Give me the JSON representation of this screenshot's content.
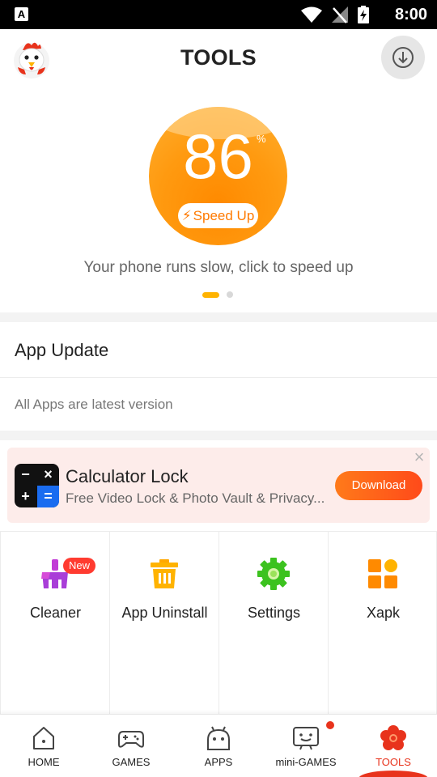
{
  "status_bar": {
    "time": "8:00",
    "left_icon": "A"
  },
  "header": {
    "title": "TOOLS"
  },
  "speed": {
    "score": "86",
    "unit": "%",
    "button_label": "Speed Up",
    "hint": "Your phone runs slow, click to speed up"
  },
  "app_update": {
    "title": "App Update",
    "status": "All Apps are latest version"
  },
  "ad": {
    "title": "Calculator Lock",
    "subtitle": "Free Video Lock & Photo Vault & Privacy...",
    "button_label": "Download",
    "icon_cells": [
      "−",
      "×",
      "+",
      "="
    ]
  },
  "tools": [
    {
      "label": "Cleaner",
      "badge": "New",
      "icon": "broom-icon"
    },
    {
      "label": "App Uninstall",
      "icon": "trash-icon"
    },
    {
      "label": "Settings",
      "icon": "gear-icon"
    },
    {
      "label": "Xapk",
      "icon": "xapk-icon"
    }
  ],
  "nav": [
    {
      "label": "HOME",
      "icon": "home-icon"
    },
    {
      "label": "GAMES",
      "icon": "gamepad-icon"
    },
    {
      "label": "APPS",
      "icon": "android-icon"
    },
    {
      "label": "mini-GAMES",
      "icon": "mini-games-icon"
    },
    {
      "label": "TOOLS",
      "icon": "flower-icon"
    }
  ],
  "colors": {
    "accent": "#ff8a00",
    "active": "#e8331c",
    "badge": "#ff3b30"
  }
}
